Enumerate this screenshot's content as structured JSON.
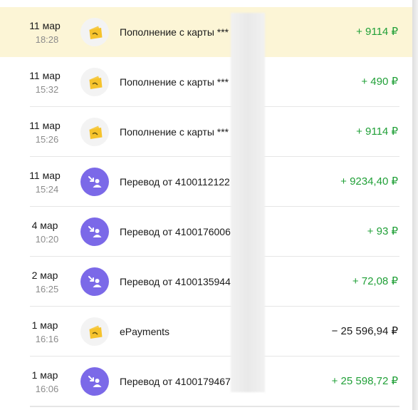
{
  "colors": {
    "income": "#21a038",
    "expense": "#1a1a1a",
    "highlight": "#fcf5d6",
    "transfer_icon_bg": "#7b69e8",
    "wallet_icon_bg": "#f3f3f3",
    "wallet_icon_fg": "#f6c32c"
  },
  "transactions": [
    {
      "date": "11 мар",
      "time": "18:28",
      "title": "Пополнение с карты ***",
      "amount": "+ 9114 ₽",
      "icon": "wallet-icon",
      "kind": "income",
      "highlighted": true
    },
    {
      "date": "11 мар",
      "time": "15:32",
      "title": "Пополнение с карты ***",
      "amount": "+ 490 ₽",
      "icon": "wallet-icon",
      "kind": "income",
      "highlighted": false
    },
    {
      "date": "11 мар",
      "time": "15:26",
      "title": "Пополнение с карты ***",
      "amount": "+ 9114 ₽",
      "icon": "wallet-icon",
      "kind": "income",
      "highlighted": false
    },
    {
      "date": "11 мар",
      "time": "15:24",
      "title": "Перевод от 4100112122",
      "amount": "+ 9234,40 ₽",
      "icon": "incoming-transfer-icon",
      "kind": "income",
      "highlighted": false
    },
    {
      "date": "4 мар",
      "time": "10:20",
      "title": "Перевод от 4100176006",
      "amount": "+ 93 ₽",
      "icon": "incoming-transfer-icon",
      "kind": "income",
      "highlighted": false
    },
    {
      "date": "2 мар",
      "time": "16:25",
      "title": "Перевод от 4100135944",
      "amount": "+ 72,08 ₽",
      "icon": "incoming-transfer-icon",
      "kind": "income",
      "highlighted": false
    },
    {
      "date": "1 мар",
      "time": "16:16",
      "title": "ePayments",
      "amount": "− 25 596,94 ₽",
      "icon": "wallet-icon",
      "kind": "expense",
      "highlighted": false
    },
    {
      "date": "1 мар",
      "time": "16:06",
      "title": "Перевод от 4100179467",
      "amount": "+ 25 598,72 ₽",
      "icon": "incoming-transfer-icon",
      "kind": "income",
      "highlighted": false
    }
  ]
}
